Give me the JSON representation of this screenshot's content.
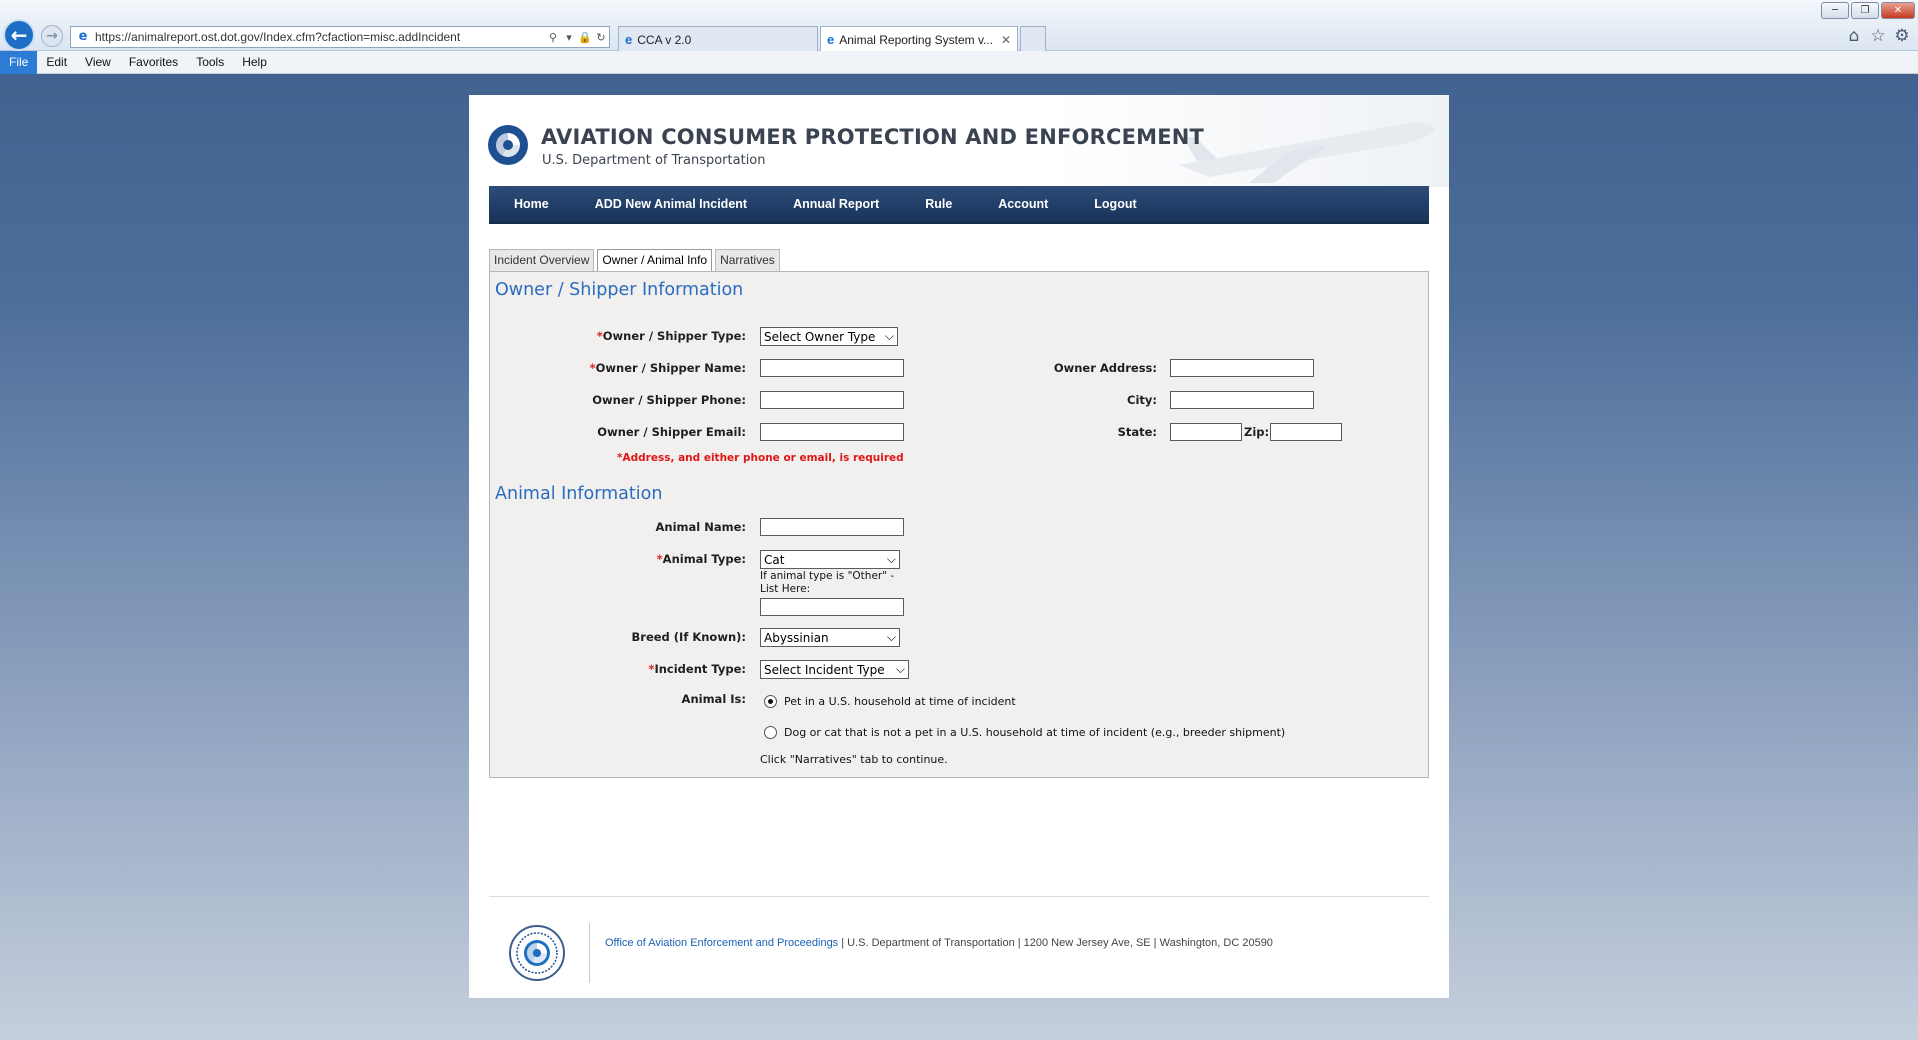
{
  "browser": {
    "url": "https://animalreport.ost.dot.gov/Index.cfm?cfaction=misc.addIncident",
    "tabs": [
      {
        "title": "CCA v 2.0"
      },
      {
        "title": "Animal Reporting System v..."
      }
    ],
    "menu": [
      "File",
      "Edit",
      "View",
      "Favorites",
      "Tools",
      "Help"
    ]
  },
  "header": {
    "title": "AVIATION CONSUMER PROTECTION AND ENFORCEMENT",
    "subtitle": "U.S. Department of Transportation"
  },
  "nav": [
    "Home",
    "ADD New Animal Incident",
    "Annual Report",
    "Rule",
    "Account",
    "Logout"
  ],
  "page_tabs": [
    "Incident Overview",
    "Owner / Animal Info",
    "Narratives"
  ],
  "owner_section": {
    "title": "Owner / Shipper Information",
    "type_label": "Owner / Shipper Type:",
    "type_value": "Select Owner Type",
    "name_label": "Owner / Shipper Name:",
    "phone_label": "Owner / Shipper Phone:",
    "email_label": "Owner / Shipper Email:",
    "address_label": "Owner Address:",
    "city_label": "City:",
    "state_label": "State:",
    "zip_label": "Zip:",
    "requirement_note": "*Address, and either phone or email, is required"
  },
  "animal_section": {
    "title": "Animal Information",
    "name_label": "Animal Name:",
    "type_label": "Animal Type:",
    "type_value": "Cat",
    "other_hint_1": "If animal type is \"Other\" -",
    "other_hint_2": "List Here:",
    "breed_label": "Breed (If Known):",
    "breed_value": "Abyssinian",
    "incident_label": "Incident Type:",
    "incident_value": "Select Incident Type",
    "animal_is_label": "Animal Is:",
    "option_pet": "Pet in a U.S. household at time of incident",
    "option_not_pet": "Dog or cat that is not a pet in a U.S. household at time of incident (e.g., breeder shipment)",
    "selected_option": "option_pet",
    "continue_hint": "Click \"Narratives\" tab to continue."
  },
  "footer": {
    "link": "Office of Aviation Enforcement and Proceedings",
    "text": " | U.S. Department of Transportation | 1200 New Jersey Ave, SE | Washington, DC 20590"
  },
  "colors": {
    "navbar": "#1f3d66",
    "section_title": "#2a6cbf",
    "required": "#e01616"
  }
}
